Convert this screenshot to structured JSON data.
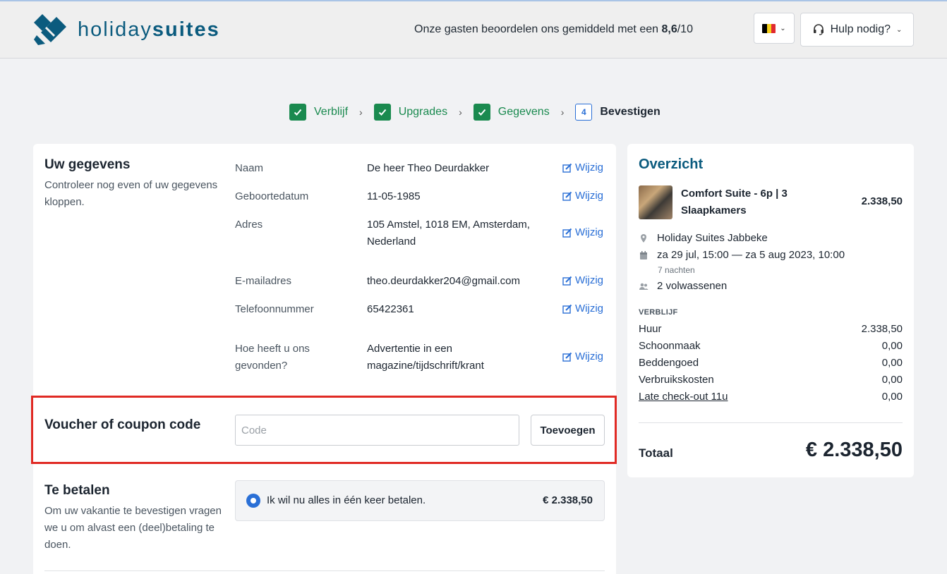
{
  "header": {
    "logo_light": "holiday",
    "logo_bold": "suites",
    "rating_prefix": "Onze gasten beoordelen ons gemiddeld met een ",
    "rating_score": "8,6",
    "rating_suffix": "/10",
    "help_label": "Hulp nodig?",
    "flag_colors": [
      "#000000",
      "#f6d11d",
      "#e02a30"
    ]
  },
  "steps": [
    {
      "label": "Verblijf",
      "state": "done"
    },
    {
      "label": "Upgrades",
      "state": "done"
    },
    {
      "label": "Gegevens",
      "state": "done"
    },
    {
      "number": "4",
      "label": "Bevestigen",
      "state": "current"
    }
  ],
  "details": {
    "title": "Uw gegevens",
    "description": "Controleer nog even of uw gegevens kloppen.",
    "edit_label": "Wijzig",
    "rows": [
      {
        "label": "Naam",
        "value": "De heer Theo Deurdakker"
      },
      {
        "label": "Geboortedatum",
        "value": "11-05-1985"
      },
      {
        "label": "Adres",
        "value": "105 Amstel, 1018 EM, Amsterdam, Nederland"
      },
      {
        "label": "E-mailadres",
        "value": "theo.deurdakker204@gmail.com"
      },
      {
        "label": "Telefoonnummer",
        "value": "65422361"
      },
      {
        "label": "Hoe heeft u ons gevonden?",
        "value": "Advertentie in een magazine/tijdschrift/krant"
      }
    ]
  },
  "voucher": {
    "title": "Voucher of coupon code",
    "placeholder": "Code",
    "button_label": "Toevoegen"
  },
  "payment": {
    "title": "Te betalen",
    "description": "Om uw vakantie te bevestigen vragen we u om alvast een (deel)betaling te doen.",
    "option_label": "Ik wil nu alles in één keer betalen.",
    "option_amount": "€ 2.338,50"
  },
  "overview": {
    "title": "Overzicht",
    "suite_name": "Comfort Suite - 6p | 3 Slaapkamers",
    "suite_price": "2.338,50",
    "location": "Holiday Suites Jabbeke",
    "dates": "za 29 jul, 15:00 — za 5 aug 2023, 10:00",
    "nights": "7 nachten",
    "guests": "2 volwassenen",
    "category": "VERBLIJF",
    "items": [
      {
        "label": "Huur",
        "value": "2.338,50"
      },
      {
        "label": "Schoonmaak",
        "value": "0,00"
      },
      {
        "label": "Beddengoed",
        "value": "0,00"
      },
      {
        "label": "Verbruikskosten",
        "value": "0,00"
      },
      {
        "label": "Late check-out 11u",
        "value": "0,00"
      }
    ],
    "total_label": "Totaal",
    "total_value": "€ 2.338,50"
  },
  "colors": {
    "brand": "#0b5b7e",
    "success": "#1a8a4f",
    "link": "#2a6fd6",
    "highlight": "#e02a24"
  }
}
